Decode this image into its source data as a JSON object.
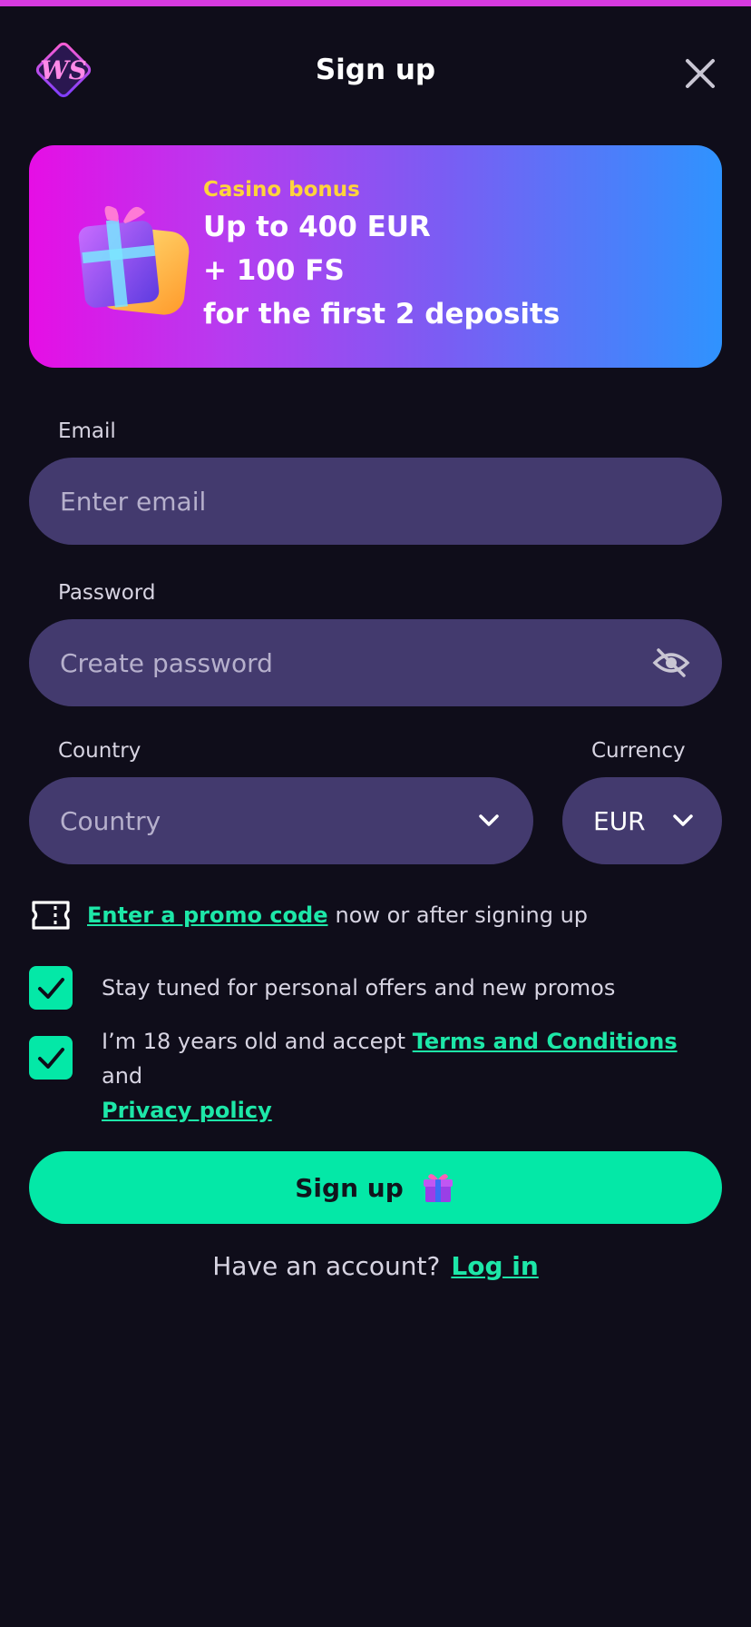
{
  "header": {
    "title": "Sign up",
    "logo_text": "WS"
  },
  "banner": {
    "eyebrow": "Casino bonus",
    "line1": "Up to 400 EUR",
    "line2": "+ 100 FS",
    "line3": "for the first 2 deposits"
  },
  "form": {
    "email": {
      "label": "Email",
      "placeholder": "Enter email",
      "value": ""
    },
    "password": {
      "label": "Password",
      "placeholder": "Create password",
      "value": ""
    },
    "country": {
      "label": "Country",
      "value": "Country"
    },
    "currency": {
      "label": "Currency",
      "value": "EUR"
    }
  },
  "promo": {
    "link": "Enter a promo code",
    "rest": "now or after signing up"
  },
  "checkboxes": {
    "offers": {
      "text": "Stay tuned for personal offers and new promos",
      "checked": true
    },
    "terms": {
      "prefix": "I’m 18 years old and accept ",
      "terms_link": "Terms and Conditions",
      "middle": " and",
      "privacy_link": "Privacy policy",
      "checked": true
    }
  },
  "actions": {
    "signup_label": "Sign up",
    "login_prompt": "Have an account?",
    "login_link": "Log in"
  },
  "icons": {
    "logo": "ws-logo-icon",
    "close": "close-icon",
    "gift_banner": "gift-box-icon",
    "eye": "eye-slash-icon",
    "chevron": "chevron-down-icon",
    "ticket": "ticket-icon",
    "check": "checkmark-icon",
    "gift_button": "gift-icon"
  },
  "colors": {
    "background": "#0f0d1a",
    "accent_green": "#04e8a7",
    "input_bg": "#433a6e",
    "banner_start": "#e60ee5",
    "banner_end": "#2f93fe",
    "eyebrow_yellow": "#ffd43b",
    "top_accent": "#d63adf"
  }
}
